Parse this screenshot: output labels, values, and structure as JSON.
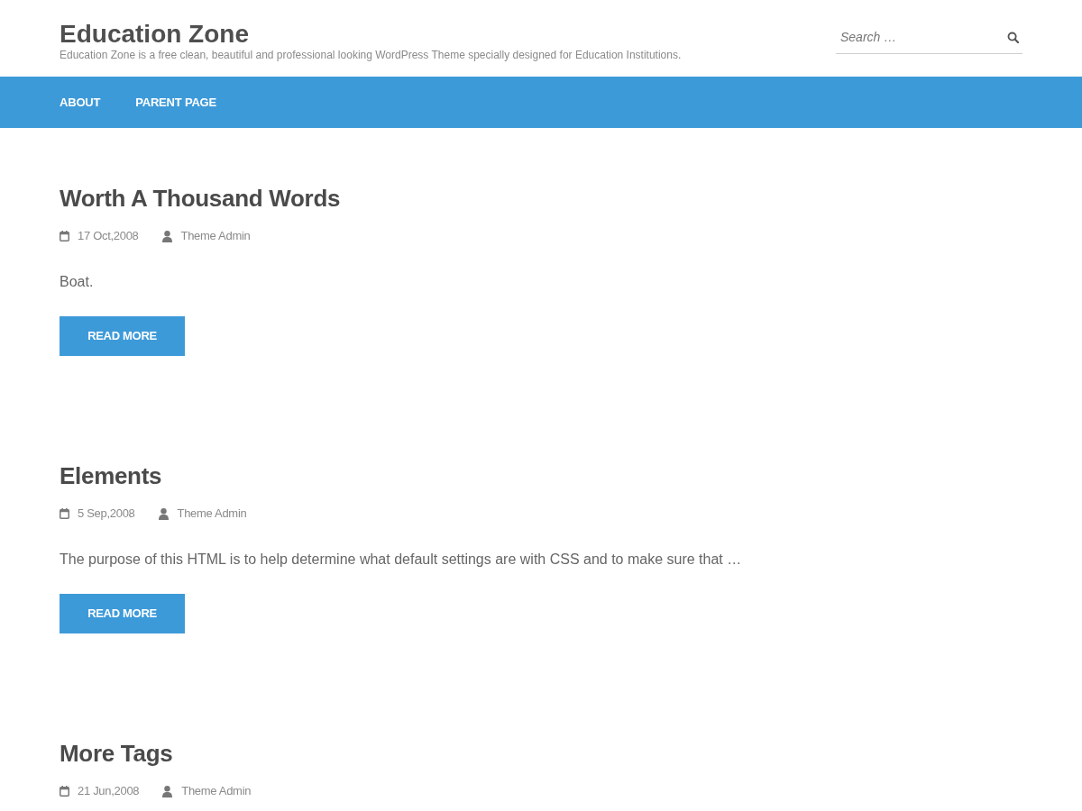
{
  "site": {
    "title": "Education Zone",
    "tagline": "Education Zone is a free clean, beautiful and professional looking WordPress Theme specially designed for Education Institutions."
  },
  "search": {
    "placeholder": "Search …"
  },
  "nav": {
    "items": [
      {
        "label": "ABOUT"
      },
      {
        "label": "PARENT PAGE"
      }
    ]
  },
  "posts": [
    {
      "title": "Worth A Thousand Words",
      "date": "17 Oct,2008",
      "author": "Theme Admin",
      "excerpt": "Boat.",
      "button": "READ MORE"
    },
    {
      "title": "Elements",
      "date": "5 Sep,2008",
      "author": "Theme Admin",
      "excerpt": "The purpose of this HTML is to help determine what default settings are with CSS and to make sure that …",
      "button": "READ MORE"
    },
    {
      "title": "More Tags",
      "date": "21 Jun,2008",
      "author": "Theme Admin"
    }
  ]
}
